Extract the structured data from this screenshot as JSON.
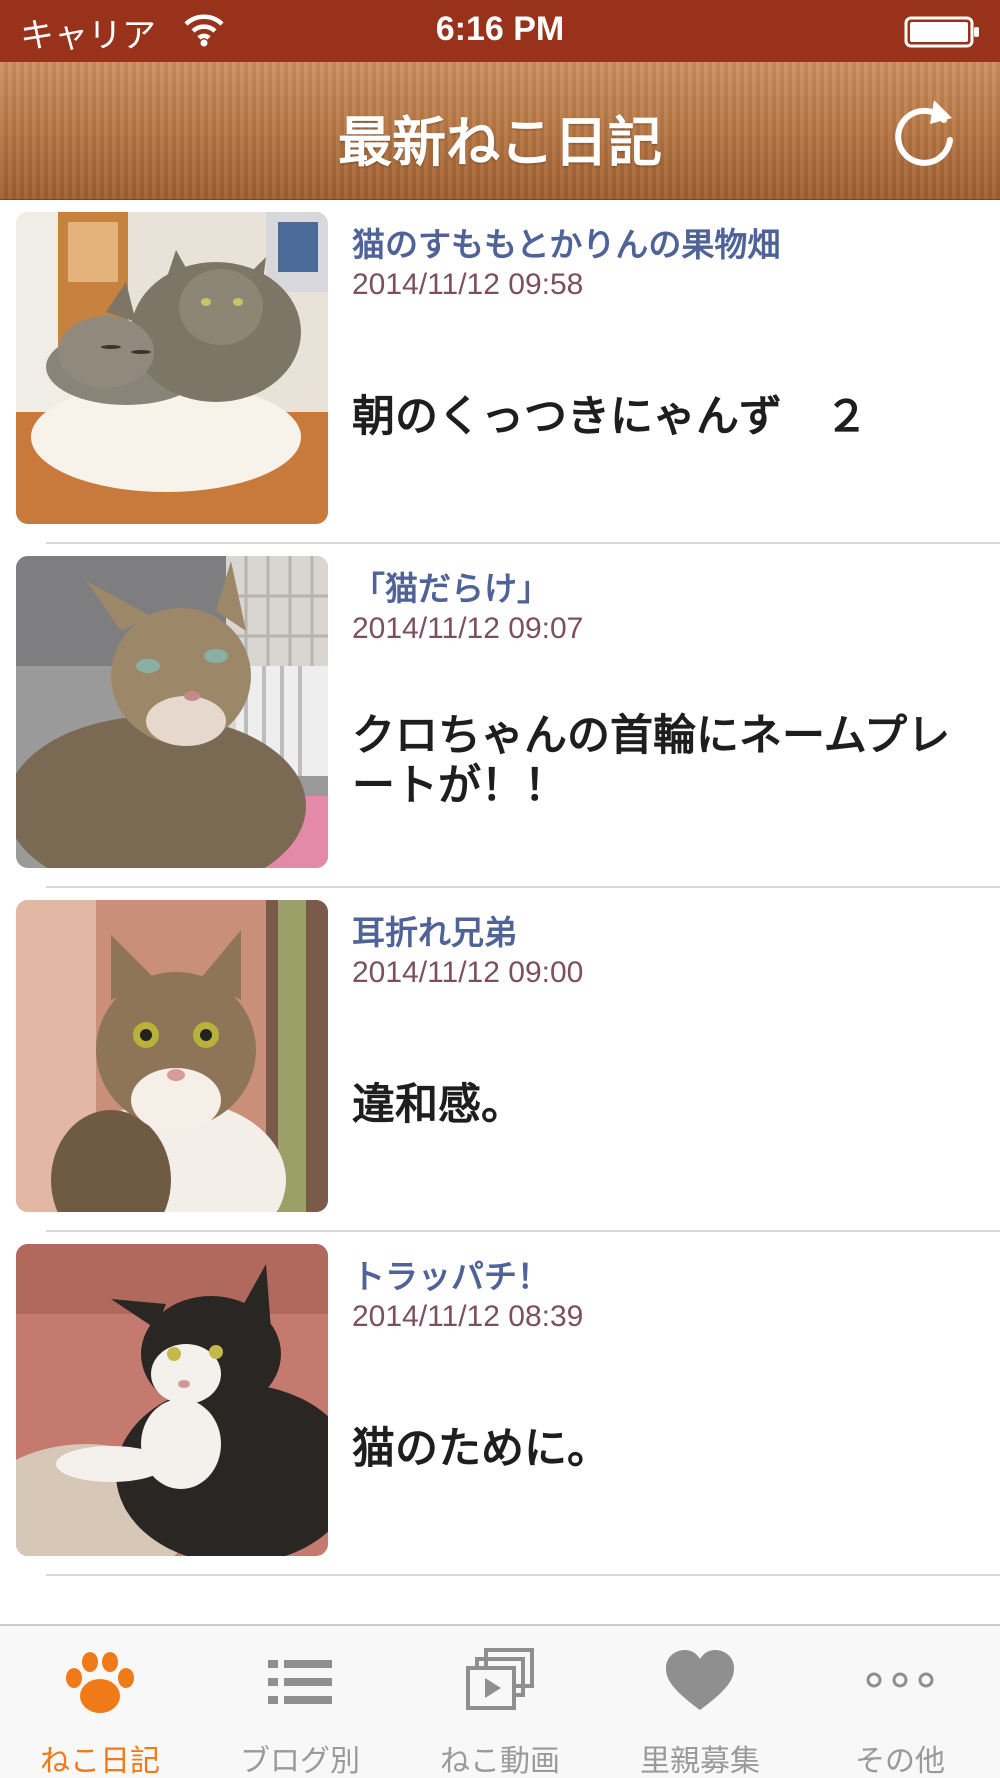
{
  "status_bar": {
    "carrier": "キャリア",
    "time": "6:16 PM"
  },
  "nav": {
    "title": "最新ねこ日記",
    "refresh_icon": "refresh-icon"
  },
  "entries": [
    {
      "blog": "猫のすももとかりんの果物畑",
      "date": "2014/11/12 09:58",
      "title": "朝のくっつきにゃんず　２"
    },
    {
      "blog": "「猫だらけ」",
      "date": "2014/11/12 09:07",
      "title": "クロちゃんの首輪にネームプレートが！！"
    },
    {
      "blog": "耳折れ兄弟",
      "date": "2014/11/12 09:00",
      "title": "違和感。"
    },
    {
      "blog": "トラッパチ！",
      "date": "2014/11/12 08:39",
      "title": "猫のために。"
    }
  ],
  "tabs": [
    {
      "label": "ねこ日記",
      "icon": "paw-icon",
      "active": true
    },
    {
      "label": "ブログ別",
      "icon": "list-icon",
      "active": false
    },
    {
      "label": "ねこ動画",
      "icon": "video-icon",
      "active": false
    },
    {
      "label": "里親募集",
      "icon": "heart-icon",
      "active": false
    },
    {
      "label": "その他",
      "icon": "more-icon",
      "active": false
    }
  ],
  "colors": {
    "status_bar": "#98321a",
    "nav_bar": "#b77745",
    "blog_name": "#4f6398",
    "date": "#7d5060",
    "tab_active": "#f07a18",
    "tab_inactive": "#9a9a9a"
  }
}
